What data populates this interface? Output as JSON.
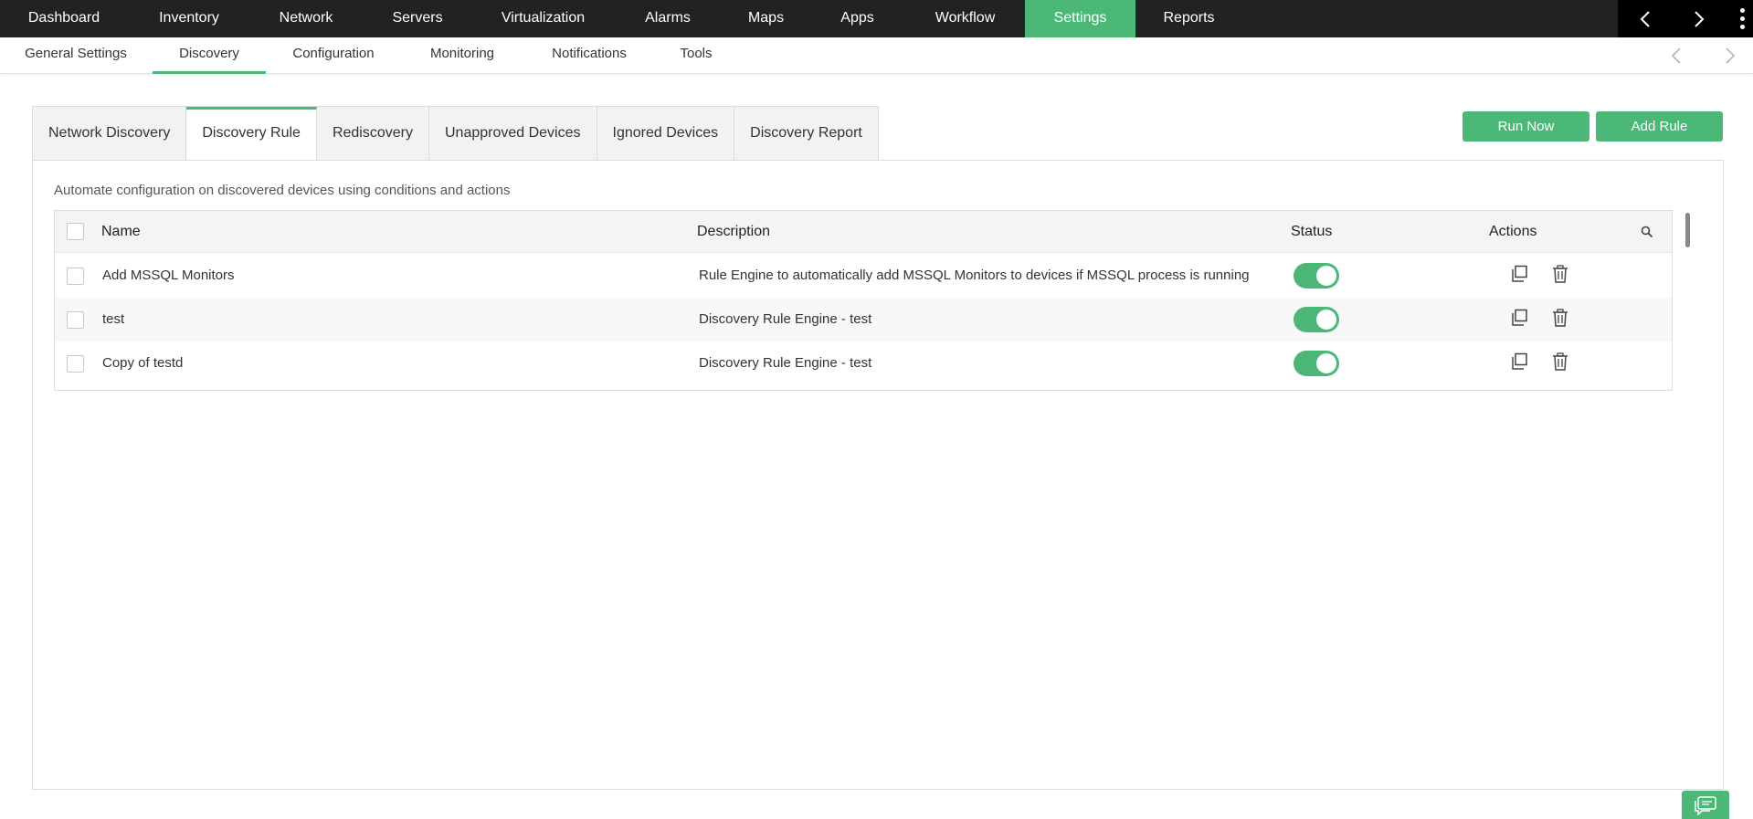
{
  "topnav": {
    "items": [
      {
        "label": "Dashboard"
      },
      {
        "label": "Inventory"
      },
      {
        "label": "Network"
      },
      {
        "label": "Servers"
      },
      {
        "label": "Virtualization"
      },
      {
        "label": "Alarms"
      },
      {
        "label": "Maps"
      },
      {
        "label": "Apps"
      },
      {
        "label": "Workflow"
      },
      {
        "label": "Settings",
        "active": true
      },
      {
        "label": "Reports"
      }
    ]
  },
  "subnav": {
    "items": [
      {
        "label": "General Settings"
      },
      {
        "label": "Discovery",
        "active": true
      },
      {
        "label": "Configuration"
      },
      {
        "label": "Monitoring"
      },
      {
        "label": "Notifications"
      },
      {
        "label": "Tools"
      }
    ]
  },
  "tabs": [
    {
      "label": "Network Discovery"
    },
    {
      "label": "Discovery Rule",
      "active": true
    },
    {
      "label": "Rediscovery"
    },
    {
      "label": "Unapproved Devices"
    },
    {
      "label": "Ignored Devices"
    },
    {
      "label": "Discovery Report"
    }
  ],
  "buttons": {
    "run_now": "Run Now",
    "add_rule": "Add Rule"
  },
  "panel": {
    "description": "Automate configuration on discovered devices using conditions and actions"
  },
  "table": {
    "columns": {
      "name": "Name",
      "description": "Description",
      "status": "Status",
      "actions": "Actions"
    },
    "rows": [
      {
        "name": "Add MSSQL Monitors",
        "description": "Rule Engine to automatically add MSSQL Monitors to devices if MSSQL process is running",
        "enabled": true
      },
      {
        "name": "test",
        "description": "Discovery Rule Engine - test",
        "enabled": true
      },
      {
        "name": "Copy of testd",
        "description": "Discovery Rule Engine - test",
        "enabled": true
      }
    ]
  },
  "colors": {
    "accent": "#4cb877",
    "topnav_bg": "#222222"
  },
  "icons": [
    "chevron-left-icon",
    "chevron-right-icon",
    "kebab-menu-icon",
    "search-icon",
    "copy-icon",
    "trash-icon",
    "chat-icon"
  ]
}
